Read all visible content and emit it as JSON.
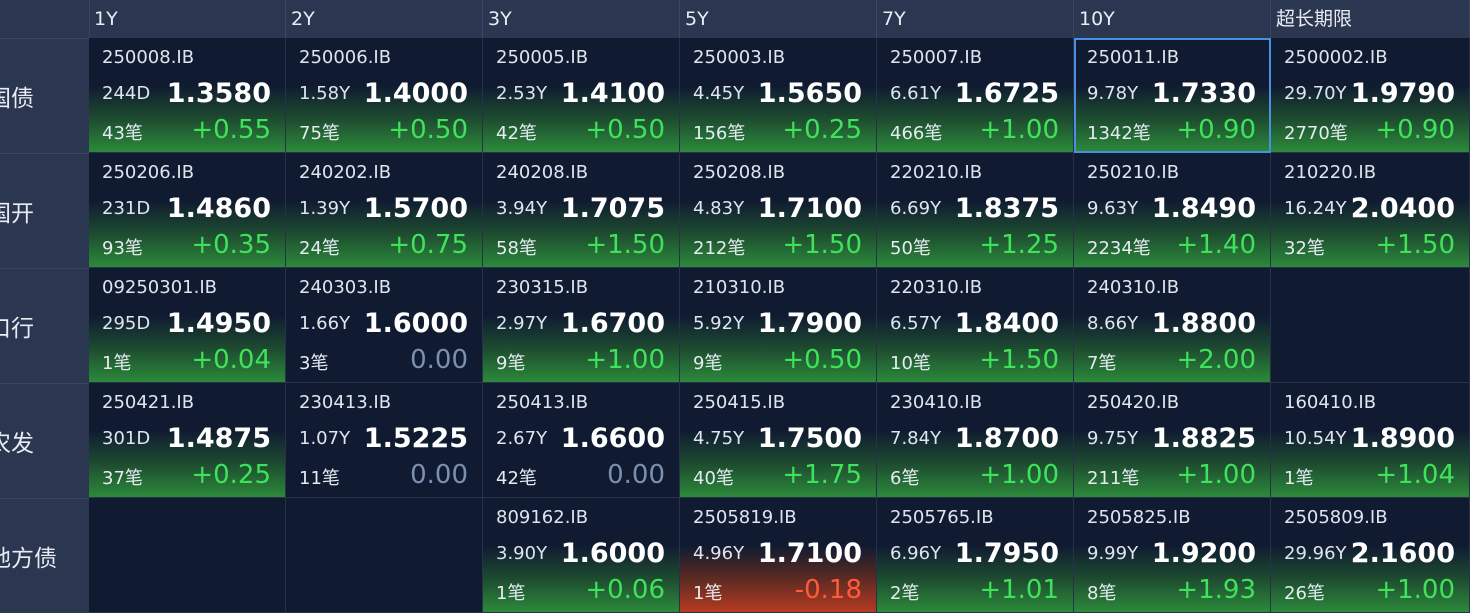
{
  "columns": [
    "1Y",
    "2Y",
    "3Y",
    "5Y",
    "7Y",
    "10Y",
    "超长期限"
  ],
  "rows": [
    {
      "label": "国债",
      "cells": [
        {
          "code": "250008.IB",
          "tenor": "244D",
          "yield": "1.3580",
          "count": "43笔",
          "change": "+0.55",
          "trend": "up"
        },
        {
          "code": "250006.IB",
          "tenor": "1.58Y",
          "yield": "1.4000",
          "count": "75笔",
          "change": "+0.50",
          "trend": "up"
        },
        {
          "code": "250005.IB",
          "tenor": "2.53Y",
          "yield": "1.4100",
          "count": "42笔",
          "change": "+0.50",
          "trend": "up"
        },
        {
          "code": "250003.IB",
          "tenor": "4.45Y",
          "yield": "1.5650",
          "count": "156笔",
          "change": "+0.25",
          "trend": "up"
        },
        {
          "code": "250007.IB",
          "tenor": "6.61Y",
          "yield": "1.6725",
          "count": "466笔",
          "change": "+1.00",
          "trend": "up"
        },
        {
          "code": "250011.IB",
          "tenor": "9.78Y",
          "yield": "1.7330",
          "count": "1342笔",
          "change": "+0.90",
          "trend": "up",
          "selected": true
        },
        {
          "code": "2500002.IB",
          "tenor": "29.70Y",
          "yield": "1.9790",
          "count": "2770笔",
          "change": "+0.90",
          "trend": "up"
        }
      ]
    },
    {
      "label": "国开",
      "cells": [
        {
          "code": "250206.IB",
          "tenor": "231D",
          "yield": "1.4860",
          "count": "93笔",
          "change": "+0.35",
          "trend": "up"
        },
        {
          "code": "240202.IB",
          "tenor": "1.39Y",
          "yield": "1.5700",
          "count": "24笔",
          "change": "+0.75",
          "trend": "up"
        },
        {
          "code": "240208.IB",
          "tenor": "3.94Y",
          "yield": "1.7075",
          "count": "58笔",
          "change": "+1.50",
          "trend": "up"
        },
        {
          "code": "250208.IB",
          "tenor": "4.83Y",
          "yield": "1.7100",
          "count": "212笔",
          "change": "+1.50",
          "trend": "up"
        },
        {
          "code": "220210.IB",
          "tenor": "6.69Y",
          "yield": "1.8375",
          "count": "50笔",
          "change": "+1.25",
          "trend": "up"
        },
        {
          "code": "250210.IB",
          "tenor": "9.63Y",
          "yield": "1.8490",
          "count": "2234笔",
          "change": "+1.40",
          "trend": "up"
        },
        {
          "code": "210220.IB",
          "tenor": "16.24Y",
          "yield": "2.0400",
          "count": "32笔",
          "change": "+1.50",
          "trend": "up"
        }
      ]
    },
    {
      "label": "口行",
      "cells": [
        {
          "code": "09250301.IB",
          "tenor": "295D",
          "yield": "1.4950",
          "count": "1笔",
          "change": "+0.04",
          "trend": "up"
        },
        {
          "code": "240303.IB",
          "tenor": "1.66Y",
          "yield": "1.6000",
          "count": "3笔",
          "change": "0.00",
          "trend": "flat"
        },
        {
          "code": "230315.IB",
          "tenor": "2.97Y",
          "yield": "1.6700",
          "count": "9笔",
          "change": "+1.00",
          "trend": "up"
        },
        {
          "code": "210310.IB",
          "tenor": "5.92Y",
          "yield": "1.7900",
          "count": "9笔",
          "change": "+0.50",
          "trend": "up"
        },
        {
          "code": "220310.IB",
          "tenor": "6.57Y",
          "yield": "1.8400",
          "count": "10笔",
          "change": "+1.50",
          "trend": "up"
        },
        {
          "code": "240310.IB",
          "tenor": "8.66Y",
          "yield": "1.8800",
          "count": "7笔",
          "change": "+2.00",
          "trend": "up"
        },
        null
      ]
    },
    {
      "label": "农发",
      "cells": [
        {
          "code": "250421.IB",
          "tenor": "301D",
          "yield": "1.4875",
          "count": "37笔",
          "change": "+0.25",
          "trend": "up"
        },
        {
          "code": "230413.IB",
          "tenor": "1.07Y",
          "yield": "1.5225",
          "count": "11笔",
          "change": "0.00",
          "trend": "flat"
        },
        {
          "code": "250413.IB",
          "tenor": "2.67Y",
          "yield": "1.6600",
          "count": "42笔",
          "change": "0.00",
          "trend": "flat"
        },
        {
          "code": "250415.IB",
          "tenor": "4.75Y",
          "yield": "1.7500",
          "count": "40笔",
          "change": "+1.75",
          "trend": "up"
        },
        {
          "code": "230410.IB",
          "tenor": "7.84Y",
          "yield": "1.8700",
          "count": "6笔",
          "change": "+1.00",
          "trend": "up"
        },
        {
          "code": "250420.IB",
          "tenor": "9.75Y",
          "yield": "1.8825",
          "count": "211笔",
          "change": "+1.00",
          "trend": "up"
        },
        {
          "code": "160410.IB",
          "tenor": "10.54Y",
          "yield": "1.8900",
          "count": "1笔",
          "change": "+1.04",
          "trend": "up"
        }
      ]
    },
    {
      "label": "地方债",
      "cells": [
        null,
        null,
        {
          "code": "809162.IB",
          "tenor": "3.90Y",
          "yield": "1.6000",
          "count": "1笔",
          "change": "+0.06",
          "trend": "up"
        },
        {
          "code": "2505819.IB",
          "tenor": "4.96Y",
          "yield": "1.7100",
          "count": "1笔",
          "change": "-0.18",
          "trend": "down"
        },
        {
          "code": "2505765.IB",
          "tenor": "6.96Y",
          "yield": "1.7950",
          "count": "2笔",
          "change": "+1.01",
          "trend": "up"
        },
        {
          "code": "2505825.IB",
          "tenor": "9.99Y",
          "yield": "1.9200",
          "count": "8笔",
          "change": "+1.93",
          "trend": "up"
        },
        {
          "code": "2505809.IB",
          "tenor": "29.96Y",
          "yield": "2.1600",
          "count": "26笔",
          "change": "+1.00",
          "trend": "up"
        }
      ]
    }
  ],
  "colors": {
    "up": "#3fe25a",
    "flat": "#7b8fb0",
    "down": "#ff5a3a",
    "selected_border": "#4a90e2"
  }
}
